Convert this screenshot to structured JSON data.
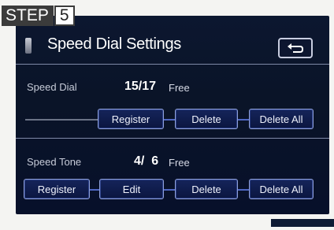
{
  "step": {
    "word": "STEP",
    "number": "5"
  },
  "screen": {
    "title": "Speed Dial Settings",
    "back_symbol": "⮌",
    "speed_dial": {
      "label": "Speed Dial",
      "count": "15/17",
      "free": "Free",
      "buttons": [
        "Register",
        "Delete",
        "Delete All"
      ]
    },
    "speed_tone": {
      "label": "Speed Tone",
      "count": "4/  6",
      "free": "Free",
      "buttons": [
        "Register",
        "Edit",
        "Delete",
        "Delete All"
      ]
    }
  },
  "icons": {
    "phone": "phone-icon",
    "back": "back-arrow-icon"
  },
  "colors": {
    "screen_bg": "#0a1428",
    "button_border": "#8fa0d8",
    "step_badge": "#3b3b3b"
  }
}
